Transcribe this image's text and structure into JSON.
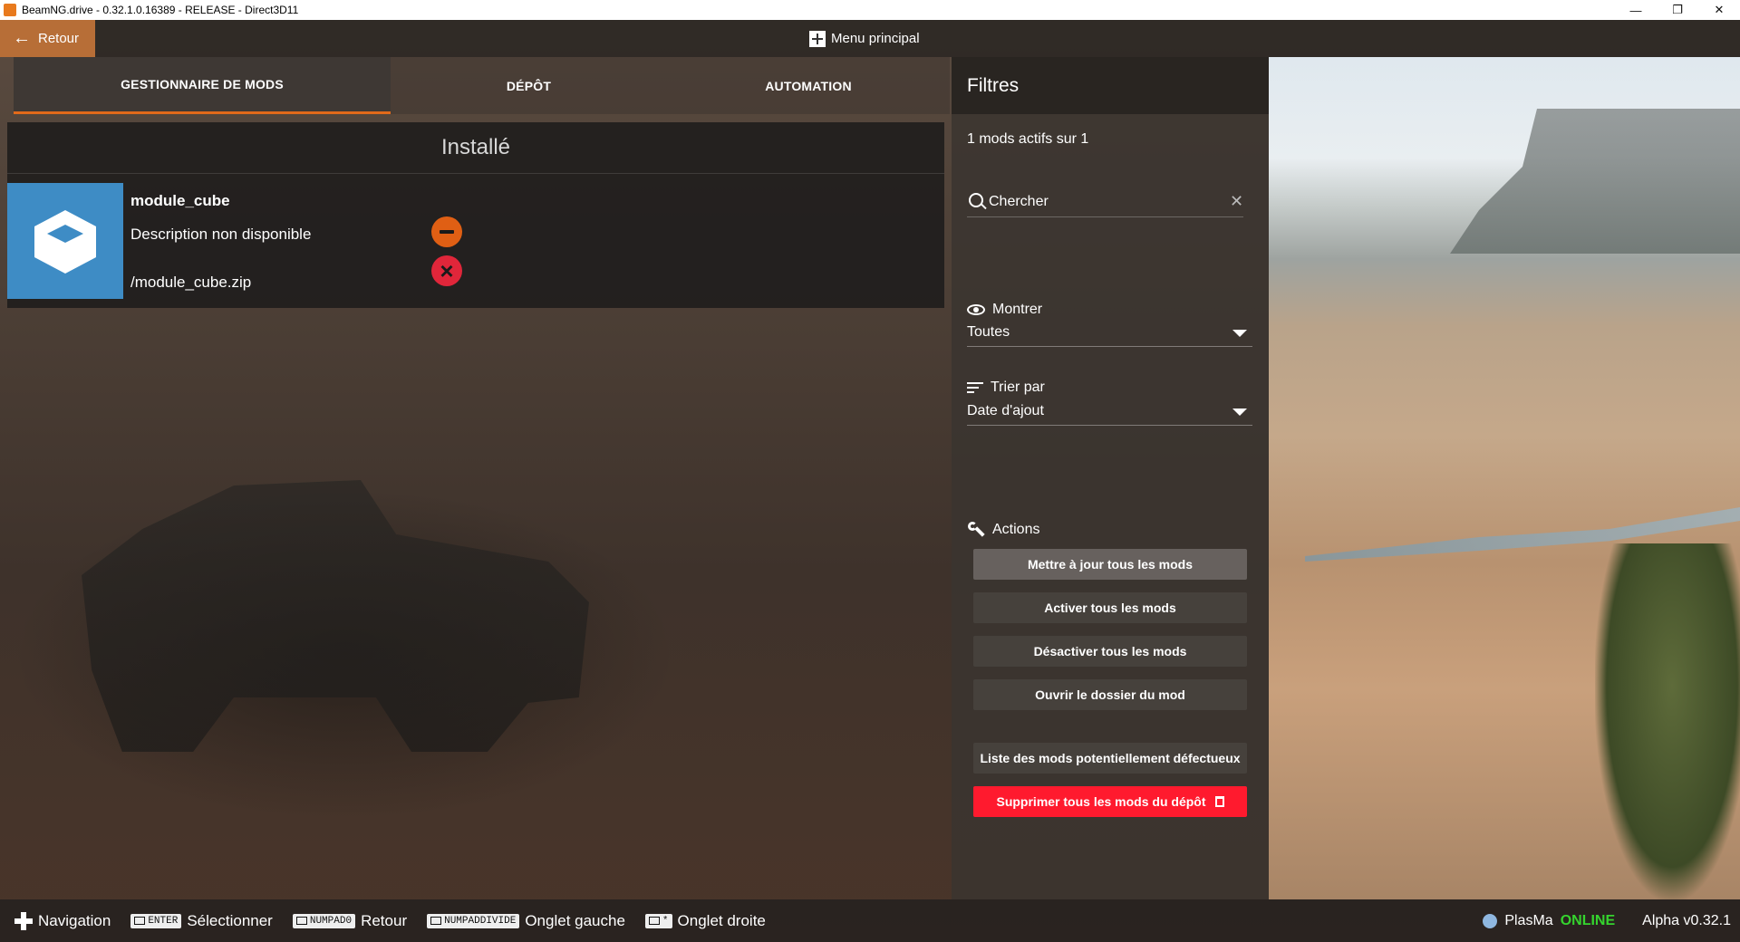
{
  "window": {
    "title": "BeamNG.drive - 0.32.1.0.16389 - RELEASE - Direct3D11",
    "controls": [
      "—",
      "❐",
      "✕"
    ]
  },
  "topbar": {
    "back_label": "Retour",
    "menu_label": "Menu principal"
  },
  "tabs": [
    {
      "label": "GESTIONNAIRE DE MODS",
      "active": true
    },
    {
      "label": "DÉPÔT",
      "active": false
    },
    {
      "label": "AUTOMATION",
      "active": false
    }
  ],
  "installed": {
    "heading": "Installé",
    "mods": [
      {
        "name": "module_cube",
        "description": "Description non disponible",
        "path": "/module_cube.zip",
        "disable_icon": "minus-circle-icon",
        "delete_icon": "x-circle-icon"
      }
    ]
  },
  "filters": {
    "heading": "Filtres",
    "active_count": "1 mods actifs sur 1",
    "search": {
      "placeholder": "Chercher",
      "value": ""
    },
    "show": {
      "label": "Montrer",
      "selected": "Toutes"
    },
    "sort": {
      "label": "Trier par",
      "selected": "Date d'ajout"
    },
    "actions": {
      "label": "Actions",
      "buttons": [
        "Mettre à jour tous les mods",
        "Activer tous les mods",
        "Désactiver tous les mods",
        "Ouvrir le dossier du mod"
      ],
      "faulty_list": "Liste des mods potentiellement défectueux",
      "delete_all": "Supprimer tous les mods du dépôt"
    }
  },
  "bottom_hints": [
    {
      "key": "",
      "icon": "dpad-icon",
      "label": "Navigation"
    },
    {
      "key": "ENTER",
      "icon": "keyboard-icon",
      "label": "Sélectionner"
    },
    {
      "key": "NUMPAD0",
      "icon": "keyboard-icon",
      "label": "Retour"
    },
    {
      "key": "NUMPADDIVIDE",
      "icon": "keyboard-icon",
      "label": "Onglet gauche"
    },
    {
      "key": "*",
      "icon": "keyboard-icon",
      "label": "Onglet droite"
    }
  ],
  "status": {
    "user": "PlasMa",
    "state": "ONLINE",
    "version": "Alpha v0.32.1"
  },
  "colors": {
    "accent": "#e26a1a",
    "back_button": "#b76e37",
    "mod_thumb": "#3e8cc5",
    "danger": "#ff1a2e",
    "online": "#35d42e"
  }
}
